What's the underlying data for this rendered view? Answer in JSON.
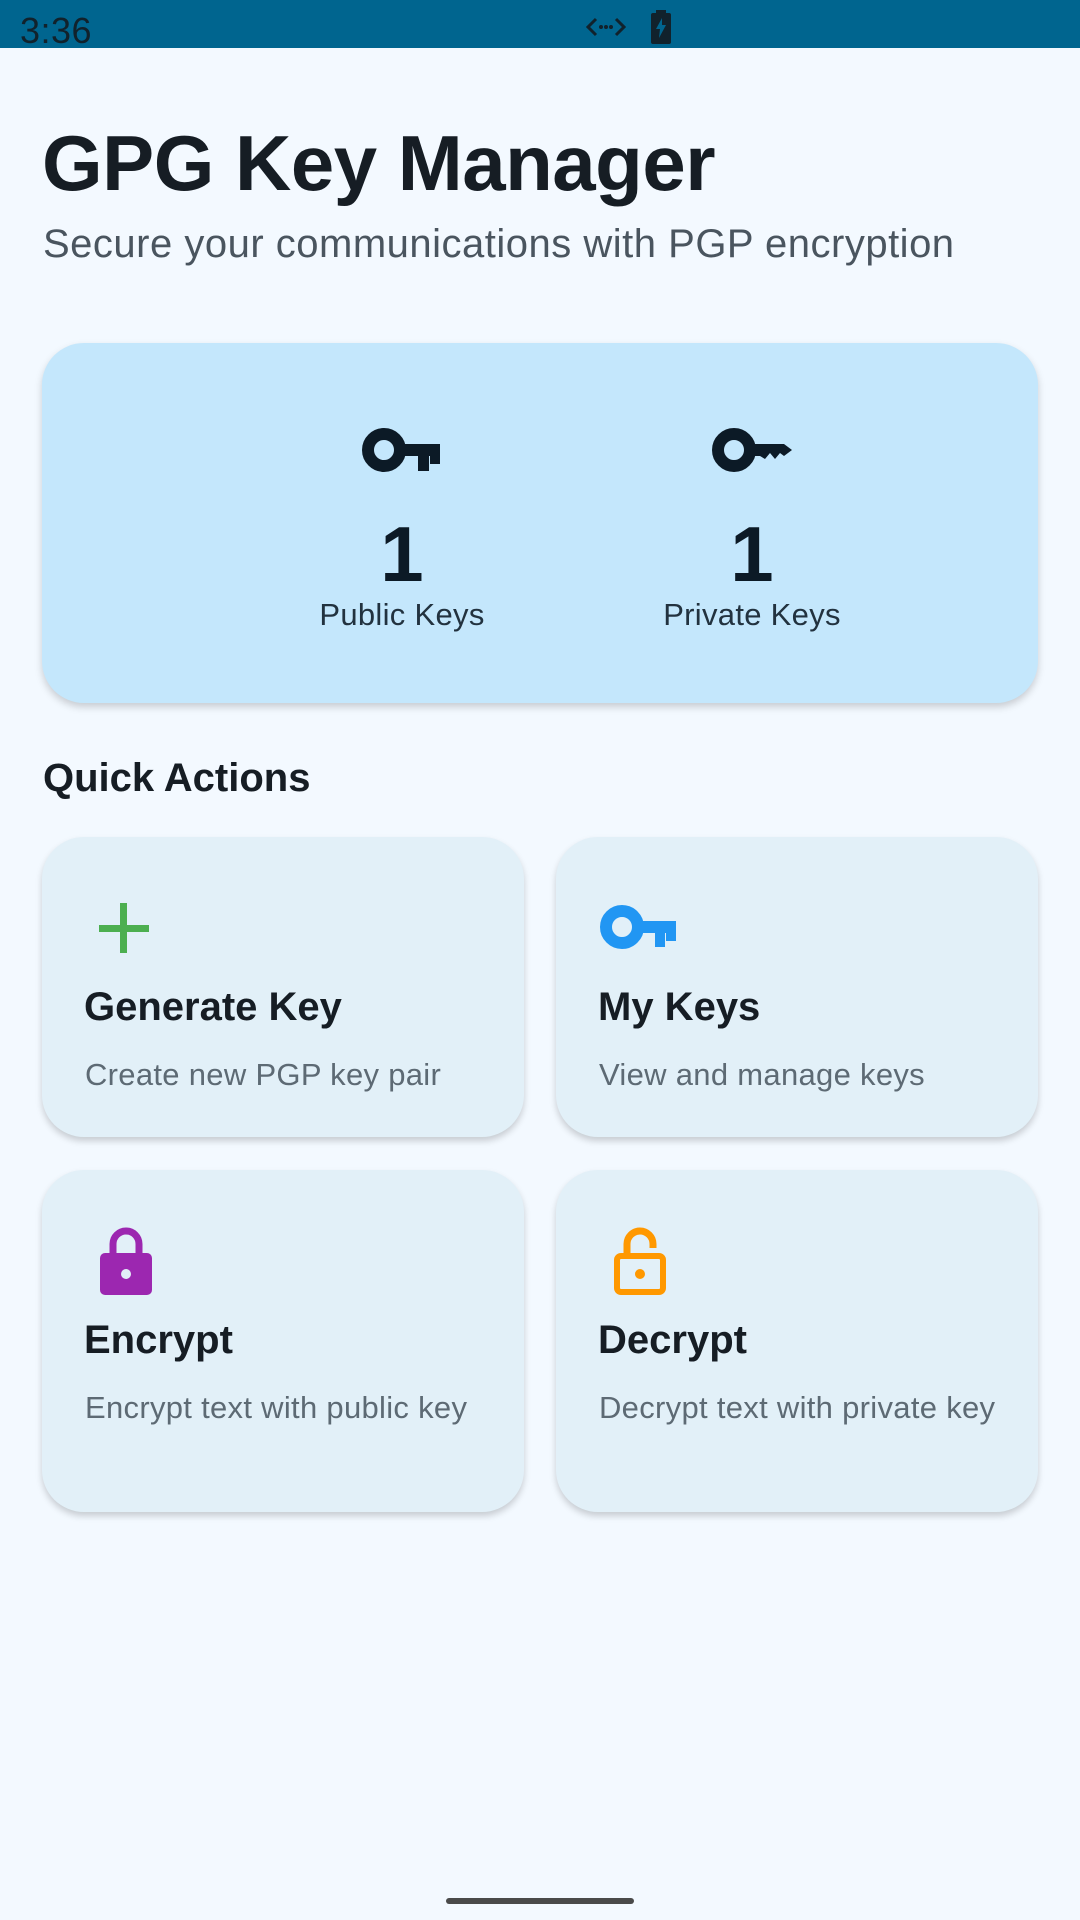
{
  "status_bar": {
    "time": "3:36",
    "icons": [
      "code-icon",
      "battery-charging-icon"
    ],
    "background": "#00658f"
  },
  "header": {
    "title": "GPG Key Manager",
    "subtitle": "Secure your communications with PGP encryption"
  },
  "stats": {
    "public": {
      "value": "1",
      "label": "Public Keys",
      "icon": "key-icon"
    },
    "private": {
      "value": "1",
      "label": "Private Keys",
      "icon": "vpn-key-icon"
    },
    "background": "#c4e7fc"
  },
  "quick_actions": {
    "title": "Quick Actions",
    "items": [
      {
        "title": "Generate Key",
        "description": "Create new PGP key pair",
        "icon": "plus-icon",
        "color": "#4caf50"
      },
      {
        "title": "My Keys",
        "description": "View and manage keys",
        "icon": "key-icon",
        "color": "#2196f3"
      },
      {
        "title": "Encrypt",
        "description": "Encrypt text with public key",
        "icon": "lock-icon",
        "color": "#9c27b0"
      },
      {
        "title": "Decrypt",
        "description": "Decrypt text with private key",
        "icon": "lock-open-icon",
        "color": "#ff9800"
      }
    ]
  }
}
